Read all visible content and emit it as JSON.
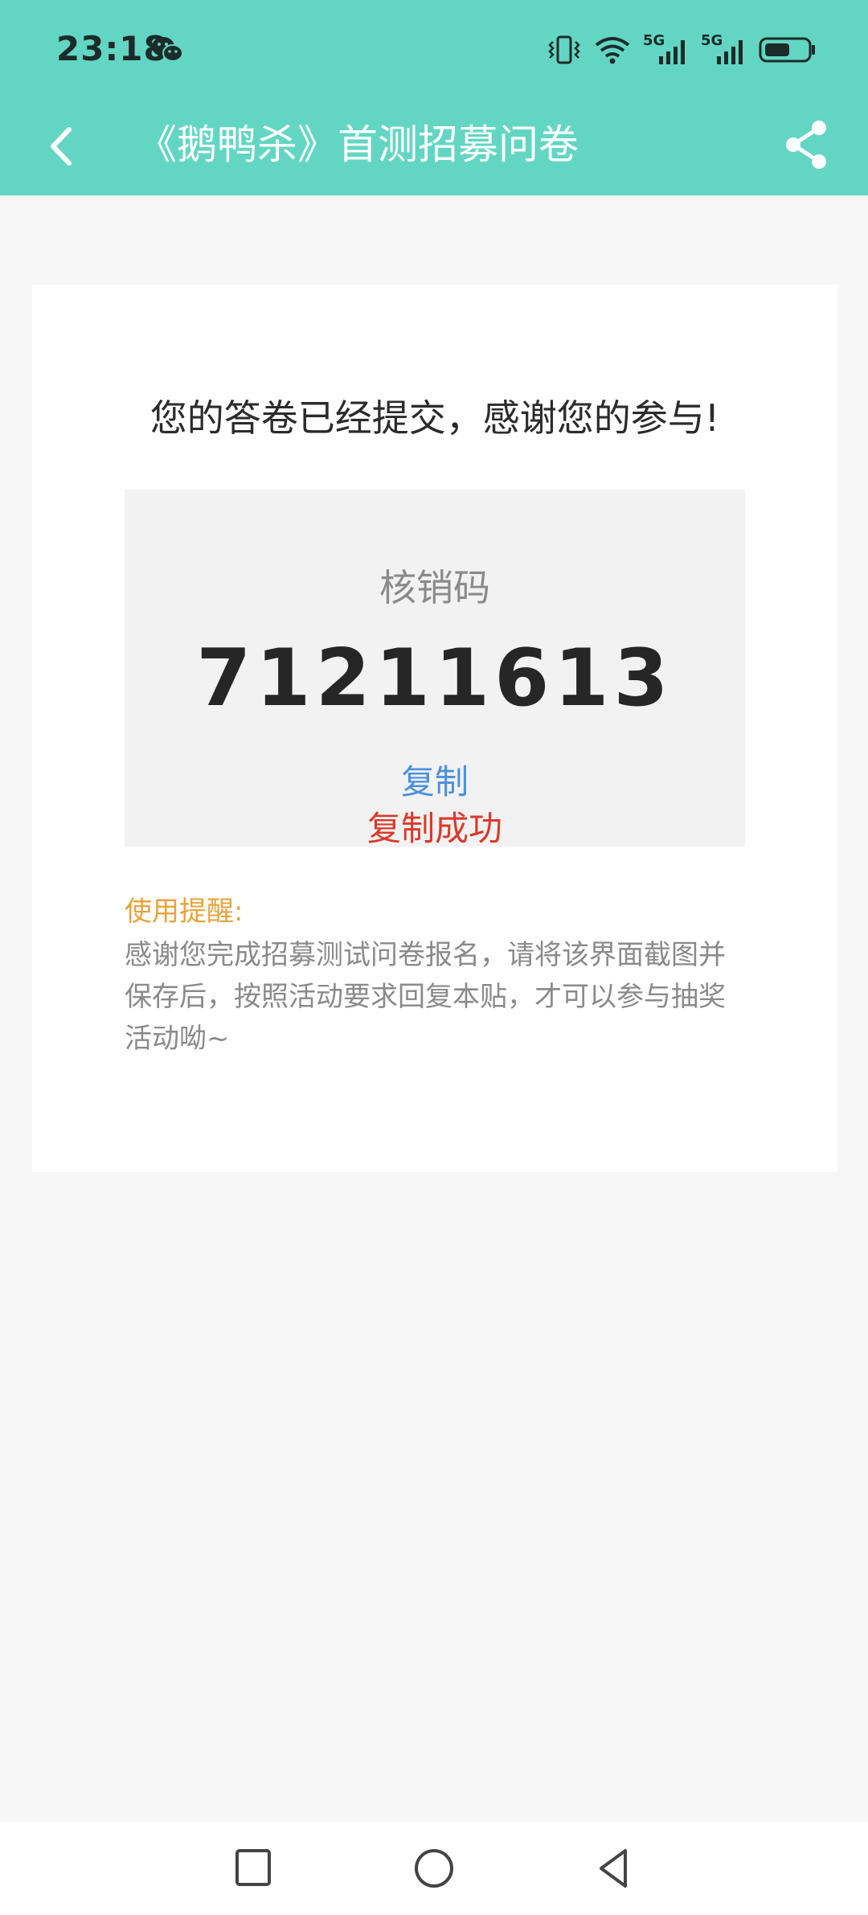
{
  "status_bar": {
    "time": "23:18",
    "icons": [
      "wechat-icon",
      "vibrate-icon",
      "wifi-icon",
      "signal-5g-icon",
      "signal-5g-icon",
      "battery-icon"
    ],
    "network_label_1": "5G",
    "network_label_2": "5G"
  },
  "header": {
    "title": "《鹅鸭杀》首测招募问卷",
    "back_icon": "chevron-left-icon",
    "share_icon": "share-icon",
    "bg_color": "#62d6c3"
  },
  "card": {
    "headline": "您的答卷已经提交，感谢您的参与!",
    "code_label": "核销码",
    "code_value": "71211613",
    "copy_label": "复制",
    "copy_success": "复制成功",
    "tip_title": "使用提醒:",
    "tip_text": "感谢您完成招募测试问卷报名，请将该界面截图并保存后，按照活动要求回复本贴，才可以参与抽奖活动呦~"
  },
  "colors": {
    "accent": "#62d6c3",
    "copy": "#4b8fe0",
    "success": "#d93a2b",
    "tip_title": "#e7a33b"
  },
  "system_nav": {
    "recent_icon": "square-icon",
    "home_icon": "circle-icon",
    "back_icon": "triangle-back-icon"
  }
}
